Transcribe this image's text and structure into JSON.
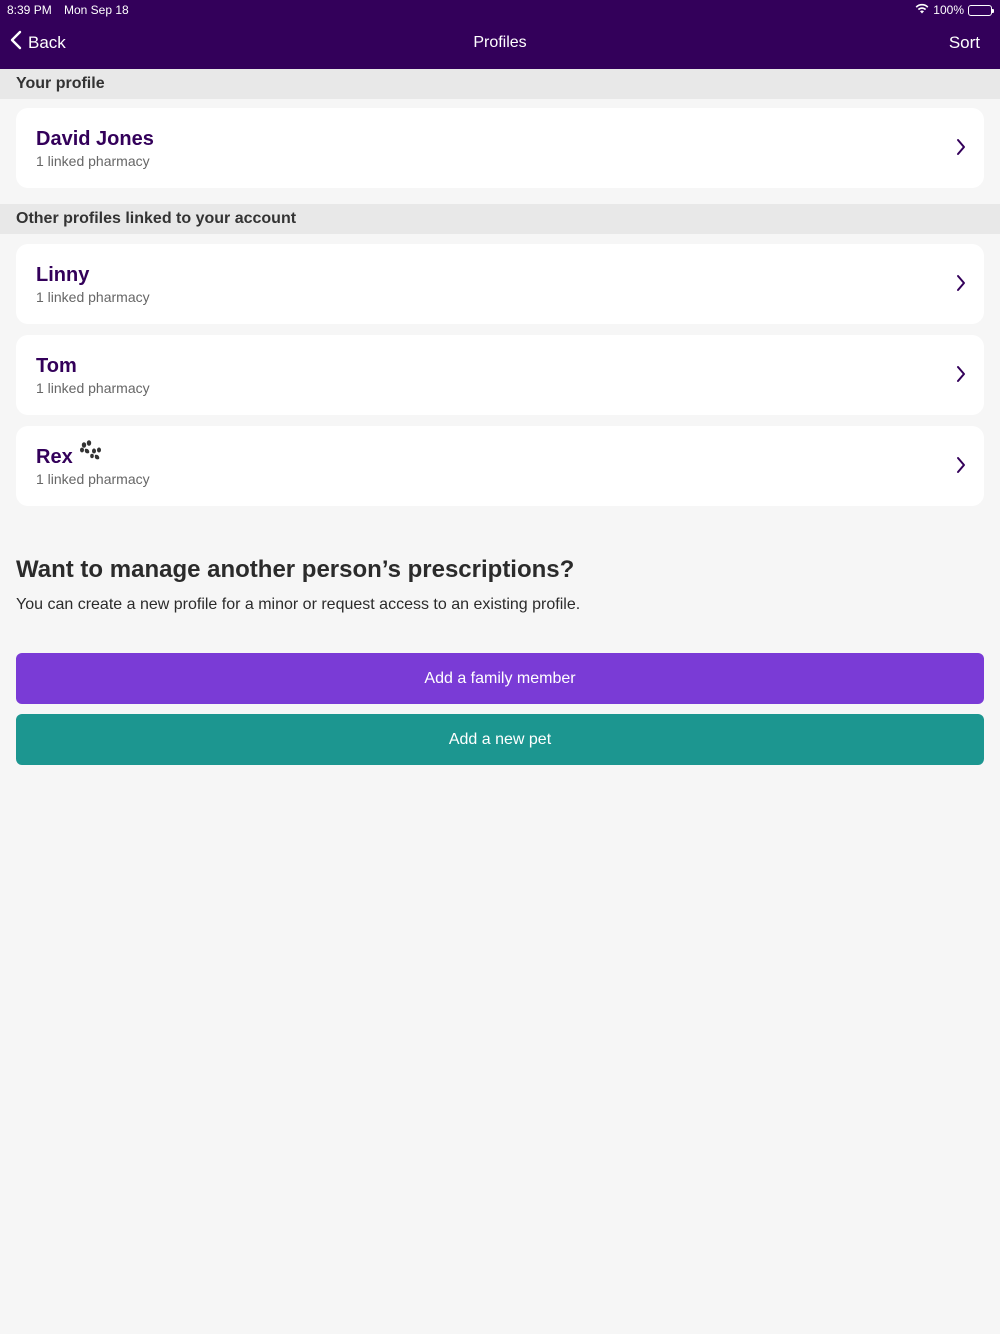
{
  "status_bar": {
    "time": "8:39 PM",
    "date": "Mon Sep 18",
    "battery": "100%"
  },
  "nav": {
    "back_label": "Back",
    "title": "Profiles",
    "sort_label": "Sort"
  },
  "your_profile": {
    "header": "Your profile",
    "card": {
      "name": "David Jones",
      "subtitle": "1 linked pharmacy"
    }
  },
  "other_profiles": {
    "header": "Other profiles linked to your account",
    "items": [
      {
        "name": "Linny",
        "subtitle": "1 linked pharmacy"
      },
      {
        "name": "Tom",
        "subtitle": "1 linked pharmacy"
      },
      {
        "name": "Rex",
        "subtitle": "1 linked pharmacy",
        "icon": "paw-icon"
      }
    ]
  },
  "promo": {
    "title": "Want to manage another person’s prescriptions?",
    "text": "You can create a new profile for a minor or request access to an existing profile."
  },
  "buttons": {
    "family_label": "Add a family member",
    "pet_label": "Add a new pet"
  },
  "colors": {
    "header_bg": "#33005a",
    "family_button": "#7a3bd6",
    "pet_button": "#1c9690"
  }
}
